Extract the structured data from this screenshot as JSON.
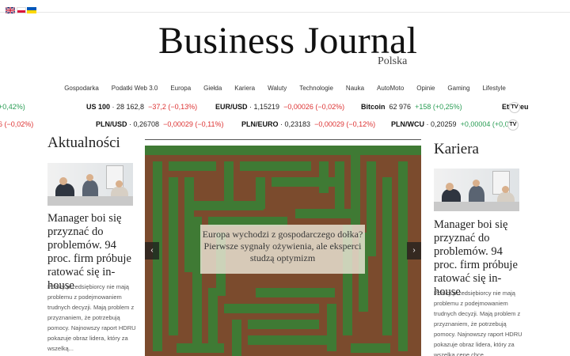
{
  "languages": [
    {
      "code": "en",
      "icon": "uk-flag-icon"
    },
    {
      "code": "pl",
      "icon": "poland-flag-icon"
    },
    {
      "code": "uk",
      "icon": "ukraine-flag-icon"
    }
  ],
  "site": {
    "title": "Business Journal",
    "subtitle": "Polska"
  },
  "nav": [
    "Gospodarka",
    "Podatki Web 3.0",
    "Europa",
    "Giełda",
    "Kariera",
    "Waluty",
    "Technologie",
    "Nauka",
    "AutoMoto",
    "Opinie",
    "Gaming",
    "Lifestyle"
  ],
  "ticker1": [
    {
      "sym": "",
      "val": "",
      "chg": "+0,42%)",
      "dir": "up"
    },
    {
      "sym": "US 100",
      "val": "28 162,8",
      "chg": "−37,2 (−0,13%)",
      "dir": "down"
    },
    {
      "sym": "EUR/USD",
      "val": "1,15219",
      "chg": "−0,00026 (−0,02%)",
      "dir": "down"
    },
    {
      "sym": "Bitcoin",
      "val": "62 976",
      "chg": "+158 (+0,25%)",
      "dir": "up"
    },
    {
      "sym": "Ethereu",
      "val": "",
      "chg": "",
      "dir": "up"
    }
  ],
  "ticker2": [
    {
      "sym": "",
      "val": "",
      "chg": "6 (−0,02%)",
      "dir": "down"
    },
    {
      "sym": "PLN/USD",
      "val": "0,26708",
      "chg": "−0,00029 (−0,11%)",
      "dir": "down"
    },
    {
      "sym": "PLN/EURO",
      "val": "0,23183",
      "chg": "−0,00029 (−0,12%)",
      "dir": "down"
    },
    {
      "sym": "PLN/WCU",
      "val": "0,20259",
      "chg": "+0,00004 (+0,0",
      "dir": "up"
    }
  ],
  "ticker_badge": "TV",
  "left": {
    "section": "Aktualności",
    "headline": "Manager boi się przyznać do problemów. 94 proc. firm próbuje ratować się in-house",
    "excerpt": "Polscy przedsiębiorcy nie mają problemu z podejmowaniem trudnych decyzji. Mają problem z przyznaniem, że potrzebują pomocy. Najnowszy raport HDRU pokazuje obraz lidera, który za wszelką..."
  },
  "hero": {
    "caption": "Europa wychodzi z gospodarczego dołka? Pierwsze sygnały ożywienia, ale eksperci studzą optymizm",
    "prev": "‹",
    "next": "›"
  },
  "right": {
    "section": "Kariera",
    "headline": "Manager boi się przyznać do problemów. 94 proc. firm próbuje ratować się in-house",
    "excerpt": "Polscy przedsiębiorcy nie mają problemu z podejmowaniem trudnych decyzji. Mają problem z przyznaniem, że potrzebują pomocy. Najnowszy raport HDRU pokazuje obraz lidera, który za wszelką cenę chce"
  }
}
